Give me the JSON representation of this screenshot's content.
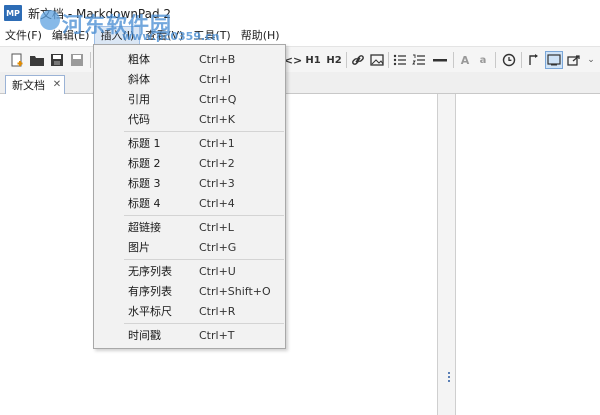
{
  "window": {
    "app_icon": "MP",
    "title": "新文档 - MarkdownPad 2"
  },
  "watermark": {
    "site": "河东软件园",
    "url": "www.pc0359.cn"
  },
  "menubar": {
    "items": [
      "文件(F)",
      "编辑(E)",
      "插入(I)",
      "查看(V)",
      "工具(T)",
      "帮助(H)"
    ],
    "active_index": 2
  },
  "toolbar": {
    "h1_label": "H1",
    "h2_label": "H2",
    "code_label": "<>",
    "font_a_large": "A",
    "font_a_small": "a"
  },
  "tabs": [
    {
      "label": "新文档",
      "close": "✕"
    }
  ],
  "insert_menu": {
    "groups": [
      [
        {
          "label": "粗体",
          "shortcut": "Ctrl+B"
        },
        {
          "label": "斜体",
          "shortcut": "Ctrl+I"
        },
        {
          "label": "引用",
          "shortcut": "Ctrl+Q"
        },
        {
          "label": "代码",
          "shortcut": "Ctrl+K"
        }
      ],
      [
        {
          "label": "标题 1",
          "shortcut": "Ctrl+1"
        },
        {
          "label": "标题 2",
          "shortcut": "Ctrl+2"
        },
        {
          "label": "标题 3",
          "shortcut": "Ctrl+3"
        },
        {
          "label": "标题 4",
          "shortcut": "Ctrl+4"
        }
      ],
      [
        {
          "label": "超链接",
          "shortcut": "Ctrl+L"
        },
        {
          "label": "图片",
          "shortcut": "Ctrl+G"
        }
      ],
      [
        {
          "label": "无序列表",
          "shortcut": "Ctrl+U"
        },
        {
          "label": "有序列表",
          "shortcut": "Ctrl+Shift+O"
        },
        {
          "label": "水平标尺",
          "shortcut": "Ctrl+R"
        }
      ],
      [
        {
          "label": "时间戳",
          "shortcut": "Ctrl+T"
        }
      ]
    ]
  },
  "icons": [
    "new-document-icon",
    "open-folder-icon",
    "save-icon",
    "save-all-icon",
    "code-icon",
    "link-icon",
    "image-icon",
    "unordered-list-icon",
    "ordered-list-icon",
    "horizontal-rule-icon",
    "timestamp-icon",
    "preview-icon",
    "export-icon",
    "toolbar-overflow-icon"
  ]
}
